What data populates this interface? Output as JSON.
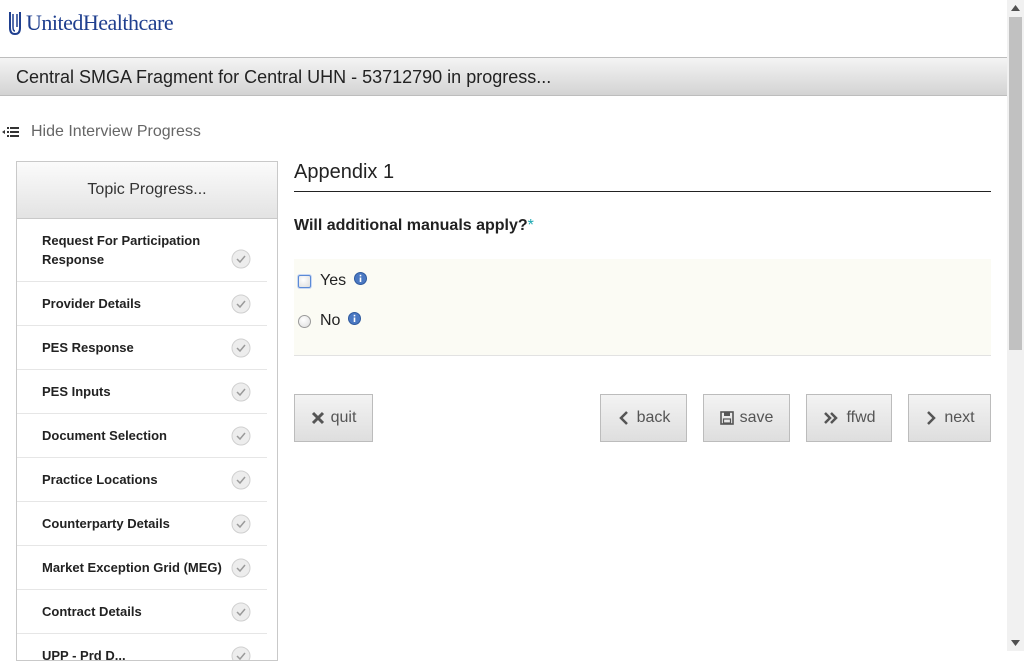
{
  "header": {
    "logo_text": "UnitedHealthcare",
    "title": "Central SMGA Fragment for Central UHN - 53712790 in progress..."
  },
  "progress_toggle": {
    "label": "Hide Interview Progress",
    "icon": "menu-collapse-icon"
  },
  "sidebar": {
    "header": "Topic Progress...",
    "items": [
      {
        "label": "Request For Participation Response",
        "status": "complete"
      },
      {
        "label": "Provider Details",
        "status": "complete"
      },
      {
        "label": "PES Response",
        "status": "complete"
      },
      {
        "label": "PES Inputs",
        "status": "complete"
      },
      {
        "label": "Document Selection",
        "status": "complete"
      },
      {
        "label": "Practice Locations",
        "status": "complete"
      },
      {
        "label": "Counterparty Details",
        "status": "complete"
      },
      {
        "label": "Market Exception Grid (MEG)",
        "status": "complete"
      },
      {
        "label": "Contract Details",
        "status": "complete"
      },
      {
        "label": "UPP - Prd D...",
        "status": "complete"
      }
    ]
  },
  "main": {
    "section_title": "Appendix 1",
    "question": "Will additional manuals apply?",
    "required_marker": "*",
    "options": [
      {
        "label": "Yes",
        "selected": false,
        "focused": true
      },
      {
        "label": "No",
        "selected": false,
        "focused": false
      }
    ]
  },
  "buttons": {
    "quit": "quit",
    "back": "back",
    "save": "save",
    "ffwd": "ffwd",
    "next": "next"
  },
  "colors": {
    "logo": "#1f3f8f",
    "required": "#1aa7b0",
    "info": "#4a78c2",
    "check": "#9a9a9a"
  }
}
